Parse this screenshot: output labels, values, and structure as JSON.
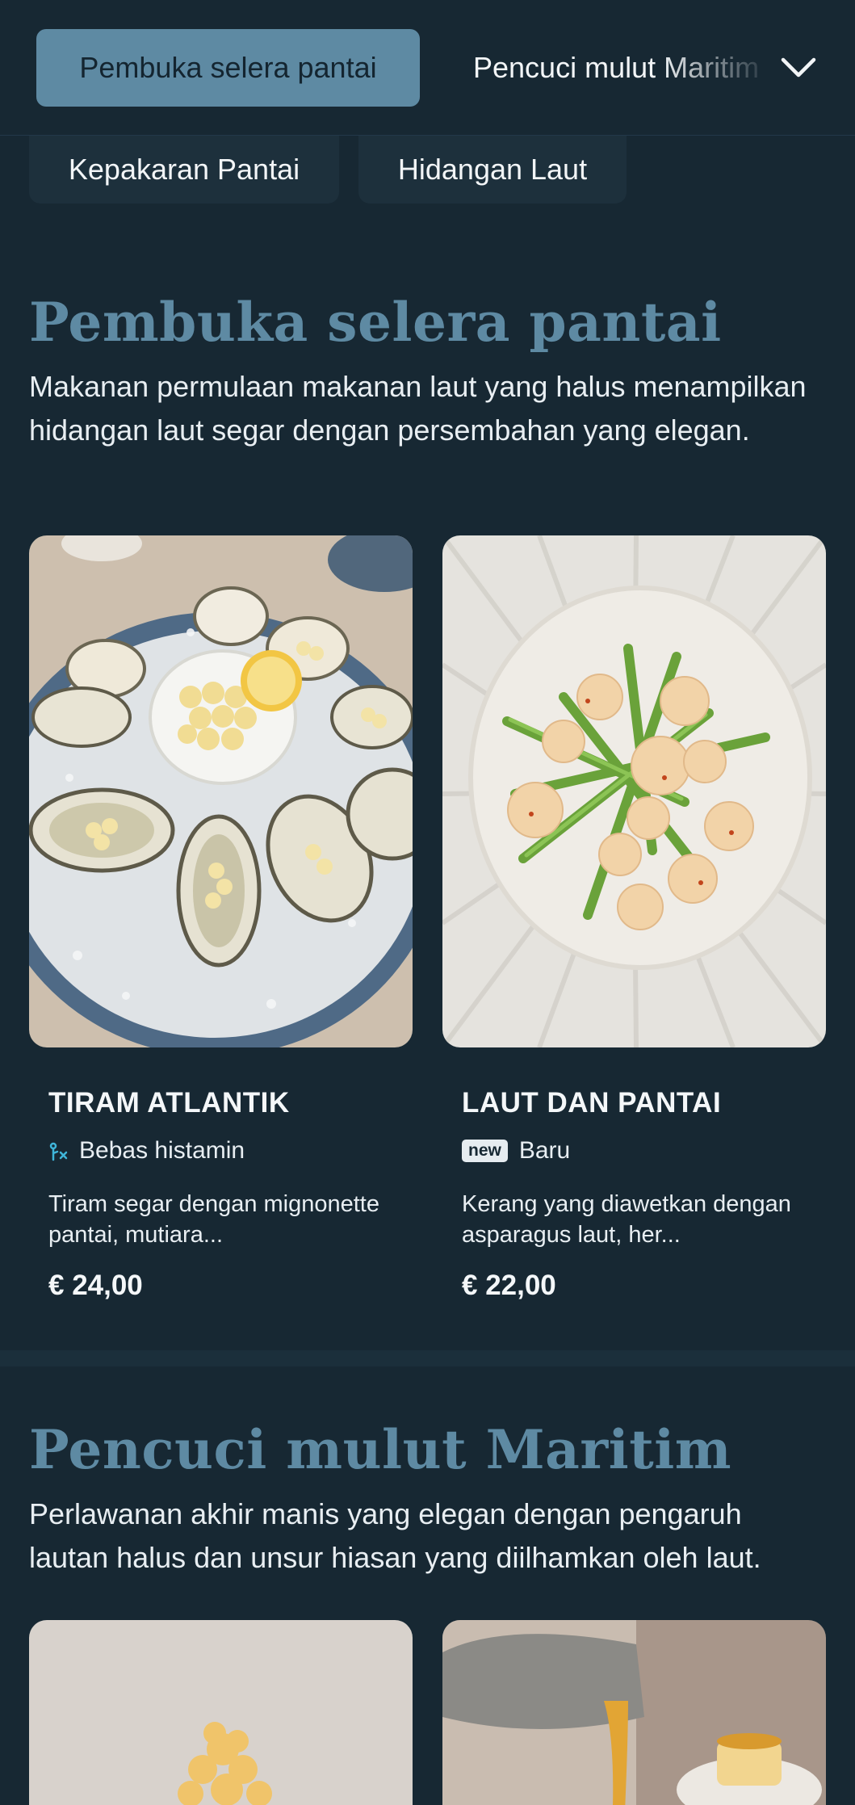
{
  "nav": {
    "active_tab": "Pembuka selera pantai",
    "next_tab": "Pencuci mulut Maritim",
    "pills": [
      "Kepakaran Pantai",
      "Hidangan Laut"
    ]
  },
  "sections": [
    {
      "title": "Pembuka selera pantai",
      "description": "Makanan permulaan makanan laut yang halus menampilkan hidangan laut segar dengan persembahan yang elegan.",
      "items": [
        {
          "name": "TIRAM ATLANTIK",
          "tag_icon": "histamine-free-icon",
          "tag": "Bebas histamin",
          "description": "Tiram segar dengan mignonette pantai, mutiara...",
          "price": "€ 24,00"
        },
        {
          "name": "LAUT DAN PANTAI",
          "tag_badge": "new",
          "tag": "Baru",
          "description": "Kerang yang diawetkan dengan asparagus laut, her...",
          "price": "€ 22,00"
        }
      ]
    },
    {
      "title": "Pencuci mulut Maritim",
      "description": "Perlawanan akhir manis yang elegan dengan pengaruh lautan halus dan unsur hiasan yang diilhamkan oleh laut."
    }
  ],
  "colors": {
    "background": "#172833",
    "accent": "#5e8aa3",
    "text": "#e8eef2"
  }
}
